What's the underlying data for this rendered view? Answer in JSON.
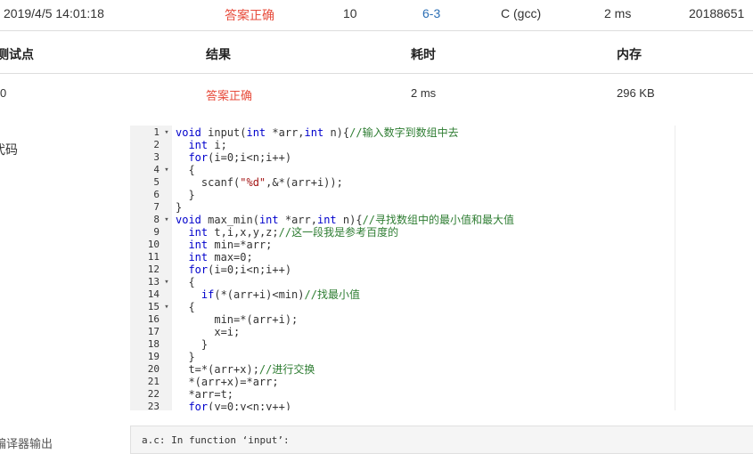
{
  "submission": {
    "time": "2019/4/5 14:01:18",
    "status": "答案正确",
    "score": "10",
    "problem": "6-3",
    "compiler": "C (gcc)",
    "duration": "2 ms",
    "user": "20188651"
  },
  "table": {
    "headers": [
      "测试点",
      "结果",
      "耗时",
      "内存"
    ],
    "rows": [
      {
        "point": "0",
        "result": "答案正确",
        "time": "2 ms",
        "memory": "296 KB"
      }
    ]
  },
  "code_label": "代码",
  "code_lines": [
    {
      "n": "1",
      "fold": true,
      "html": "<span class='kw'>void</span> input(<span class='kw'>int</span> *arr,<span class='kw'>int</span> n){<span class='cm'>//输入数字到数组中去</span>"
    },
    {
      "n": "2",
      "fold": false,
      "html": "  <span class='kw'>int</span> i;"
    },
    {
      "n": "3",
      "fold": false,
      "html": "  <span class='kw'>for</span>(i=0;i&lt;n;i++)"
    },
    {
      "n": "4",
      "fold": true,
      "html": "  {"
    },
    {
      "n": "5",
      "fold": false,
      "html": "    scanf(<span class='str'>\"%d\"</span>,&amp;*(arr+i));"
    },
    {
      "n": "6",
      "fold": false,
      "html": "  }"
    },
    {
      "n": "7",
      "fold": false,
      "html": "}"
    },
    {
      "n": "8",
      "fold": true,
      "html": "<span class='kw'>void</span> max_min(<span class='kw'>int</span> *arr,<span class='kw'>int</span> n){<span class='cm'>//寻找数组中的最小值和最大值</span>"
    },
    {
      "n": "9",
      "fold": false,
      "html": "  <span class='kw'>int</span> t,i,x,y,z;<span class='cm'>//这一段我是参考百度的</span>"
    },
    {
      "n": "10",
      "fold": false,
      "html": "  <span class='kw'>int</span> min=*arr;"
    },
    {
      "n": "11",
      "fold": false,
      "html": "  <span class='kw'>int</span> max=0;"
    },
    {
      "n": "12",
      "fold": false,
      "html": "  <span class='kw'>for</span>(i=0;i&lt;n;i++)"
    },
    {
      "n": "13",
      "fold": true,
      "html": "  {"
    },
    {
      "n": "14",
      "fold": false,
      "html": "    <span class='kw'>if</span>(*(arr+i)&lt;min)<span class='cm'>//找最小值</span>"
    },
    {
      "n": "15",
      "fold": true,
      "html": "  {"
    },
    {
      "n": "16",
      "fold": false,
      "html": "      min=*(arr+i);"
    },
    {
      "n": "17",
      "fold": false,
      "html": "      x=i;"
    },
    {
      "n": "18",
      "fold": false,
      "html": "    }"
    },
    {
      "n": "19",
      "fold": false,
      "html": "  }"
    },
    {
      "n": "20",
      "fold": false,
      "html": "  t=*(arr+x);<span class='cm'>//进行交换</span>"
    },
    {
      "n": "21",
      "fold": false,
      "html": "  *(arr+x)=*arr;"
    },
    {
      "n": "22",
      "fold": false,
      "html": "  *arr=t;"
    },
    {
      "n": "23",
      "fold": false,
      "html": "  <span class='kw'>for</span>(y=0;y&lt;n;y++)"
    }
  ],
  "compile_label": "编译器输出",
  "compile_output": "a.c: In function ‘input’:"
}
